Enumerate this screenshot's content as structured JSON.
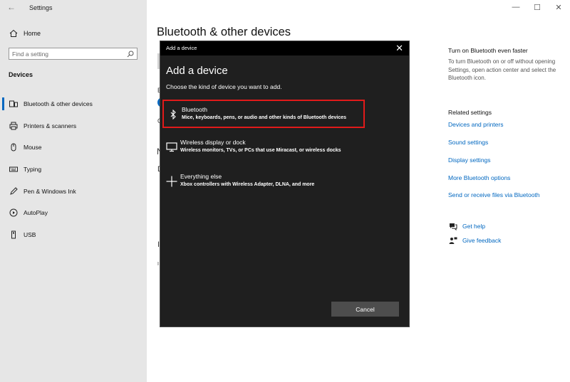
{
  "window": {
    "back_glyph": "←",
    "title": "Settings",
    "minimize_glyph": "—",
    "maximize_glyph": "☐",
    "close_glyph": "✕"
  },
  "sidebar": {
    "home_label": "Home",
    "search": {
      "placeholder": "Find a setting",
      "value": ""
    },
    "section_heading": "Devices",
    "items": [
      {
        "label": "Bluetooth & other devices",
        "icon": "bluetooth-devices-icon",
        "active": true
      },
      {
        "label": "Printers & scanners",
        "icon": "printer-icon",
        "active": false
      },
      {
        "label": "Mouse",
        "icon": "mouse-icon",
        "active": false
      },
      {
        "label": "Typing",
        "icon": "keyboard-icon",
        "active": false
      },
      {
        "label": "Pen & Windows Ink",
        "icon": "pen-icon",
        "active": false
      },
      {
        "label": "AutoPlay",
        "icon": "autoplay-icon",
        "active": false
      },
      {
        "label": "USB",
        "icon": "usb-icon",
        "active": false
      }
    ]
  },
  "main": {
    "title": "Bluetooth & other devices",
    "obscured_letters": [
      "B",
      "O",
      "N",
      "D",
      "I",
      "I"
    ]
  },
  "right": {
    "tip_heading": "Turn on Bluetooth even faster",
    "tip_text": "To turn Bluetooth on or off without opening Settings, open action center and select the Bluetooth icon.",
    "related_heading": "Related settings",
    "related_links": [
      "Devices and printers",
      "Sound settings",
      "Display settings",
      "More Bluetooth options",
      "Send or receive files via Bluetooth"
    ],
    "get_help": "Get help",
    "give_feedback": "Give feedback"
  },
  "dialog": {
    "titlebar": "Add a device",
    "close_glyph": "✕",
    "heading": "Add a device",
    "subheading": "Choose the kind of device you want to add.",
    "options": [
      {
        "name": "Bluetooth",
        "description": "Mice, keyboards, pens, or audio and other kinds of Bluetooth devices",
        "icon": "bluetooth-icon",
        "highlighted": true
      },
      {
        "name": "Wireless display or dock",
        "description": "Wireless monitors, TVs, or PCs that use Miracast, or wireless docks",
        "icon": "monitor-icon",
        "highlighted": false
      },
      {
        "name": "Everything else",
        "description": "Xbox controllers with Wireless Adapter, DLNA, and more",
        "icon": "plus-icon",
        "highlighted": false
      }
    ],
    "cancel_label": "Cancel"
  },
  "colors": {
    "accent": "#0067c0",
    "highlight_border": "#e11a1a",
    "dialog_bg": "#1f1f1f",
    "sidebar_bg": "#e6e6e6"
  }
}
